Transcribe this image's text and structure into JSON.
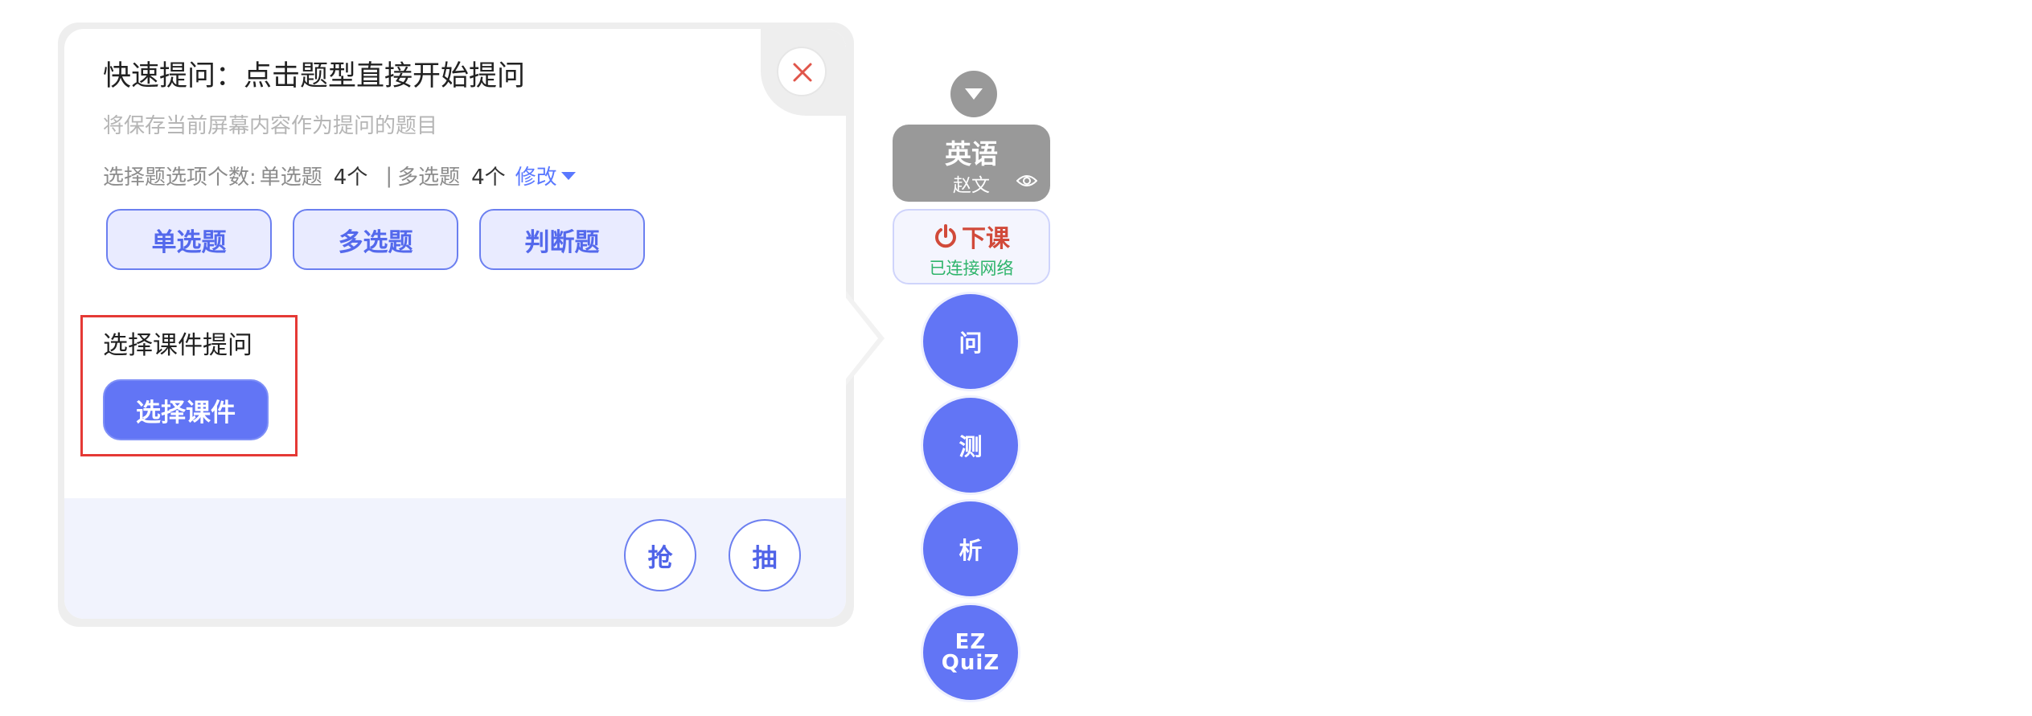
{
  "popup": {
    "title": "快速提问：点击题型直接开始提问",
    "subtitle": "将保存当前屏幕内容作为提问的题目",
    "option_count": {
      "label": "选择题选项个数:",
      "single_label": "单选题",
      "single_count": "4个",
      "separator": "|",
      "multi_label": "多选题",
      "multi_count": "4个",
      "modify_label": "修改"
    },
    "question_types": [
      "单选题",
      "多选题",
      "判断题"
    ],
    "courseware": {
      "label": "选择课件提问",
      "button_label": "选择课件"
    },
    "footer_buttons": [
      "抢",
      "抽"
    ],
    "close_icon": "close-icon"
  },
  "toolbar": {
    "collapse_icon": "caret-down-icon",
    "subject": "英语",
    "teacher": "赵文",
    "end_class_label": "下课",
    "network_status": "已连接网络",
    "tools": [
      "问",
      "测",
      "析"
    ],
    "ezquiz_top": "EZ",
    "ezquiz_bottom": "QuiZ"
  },
  "colors": {
    "accent": "#6275f5",
    "danger": "#d14a3a",
    "success": "#2fb46b",
    "highlight_border": "#e53935"
  }
}
